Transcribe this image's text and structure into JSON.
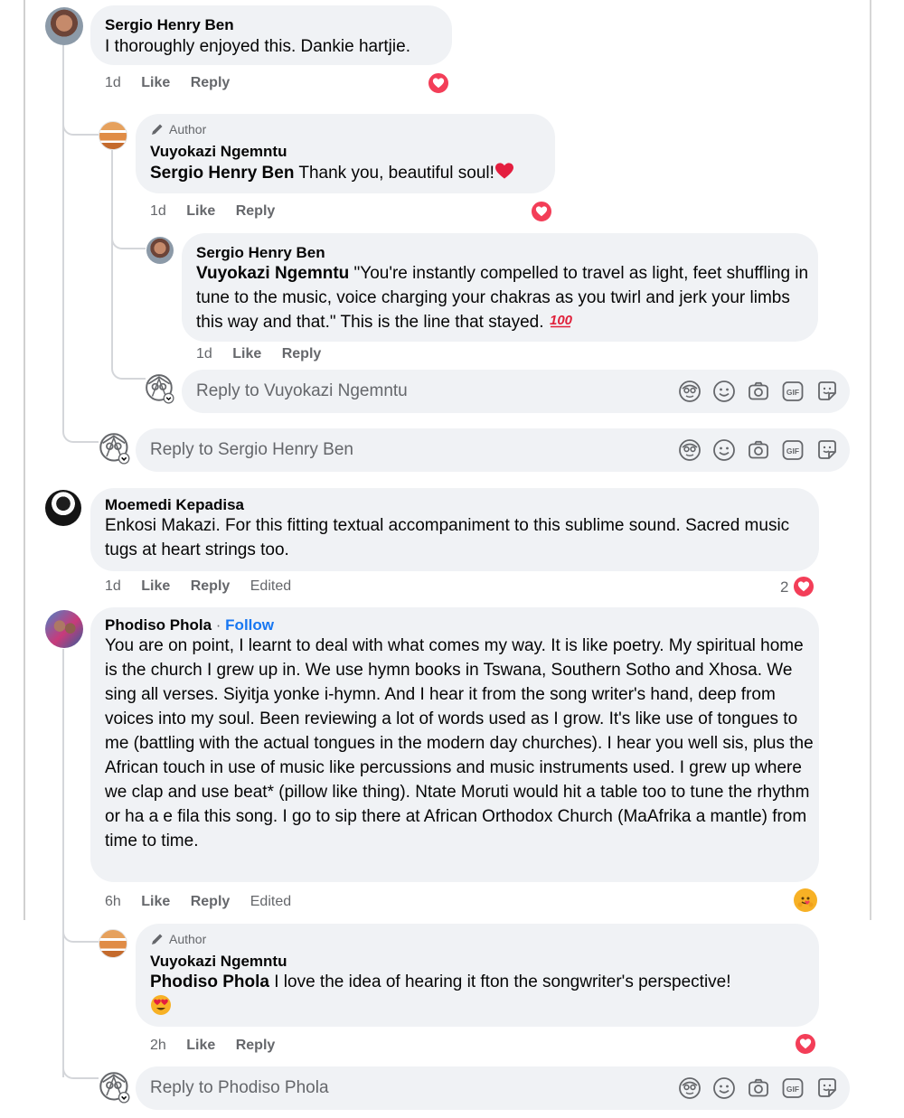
{
  "colors": {
    "bubble": "#f0f2f5",
    "link": "#1877f2",
    "muted": "#65676b",
    "heart": "#f33e58"
  },
  "icons": [
    "avatar-placeholder-icon",
    "heart-reaction-icon",
    "heart-emoji-icon",
    "hundred-points-emoji-icon",
    "hug-reaction-icon",
    "heart-eyes-emoji-icon",
    "pencil-icon",
    "avatar-sticker-icon",
    "emoji-icon",
    "camera-icon",
    "gif-icon",
    "sticker-icon"
  ],
  "comments": [
    {
      "name": "Sergio Henry Ben",
      "text": "I thoroughly enjoyed this. Dankie hartjie.",
      "time": "1d",
      "like": "Like",
      "reply": "Reply",
      "replies": [
        {
          "author_label": "Author",
          "name": "Vuyokazi Ngemntu",
          "mention": "Sergio Henry Ben",
          "text": " Thank you, beautiful soul!",
          "time": "1d",
          "like": "Like",
          "reply": "Reply",
          "replies": [
            {
              "name": "Sergio Henry Ben",
              "mention": "Vuyokazi Ngemntu",
              "text": " \"You're instantly compelled to travel as light, feet shuffling in tune to the music, voice charging your chakras as you twirl and jerk your limbs this way and that.\" This is the line that stayed. ",
              "time": "1d",
              "like": "Like",
              "reply": "Reply"
            }
          ],
          "reply_placeholder": "Reply to Vuyokazi Ngemntu"
        }
      ],
      "reply_placeholder": "Reply to Sergio Henry Ben"
    },
    {
      "name": "Moemedi Kepadisa",
      "text": "Enkosi Makazi. For this fitting textual accompaniment to this sublime sound. Sacred music tugs at heart strings too.",
      "time": "1d",
      "like": "Like",
      "reply": "Reply",
      "edited": "Edited",
      "reaction_count": "2"
    },
    {
      "name": "Phodiso Phola",
      "follow": "Follow",
      "follow_sep": " · ",
      "text": "You are on point, I learnt to deal with what comes my way. It is like poetry. My spiritual home is the church I grew up in. We use hymn books in Tswana, Southern Sotho and Xhosa. We sing all verses. Siyitja yonke i-hymn. And I hear it from the song writer's hand, deep from voices into my soul. Been reviewing a lot of words used as I grow. It's like use of tongues to me (battling with the actual tongues in the modern day churches). I hear you well sis, plus the African touch in use of music like percussions and music instruments used. I grew up where we clap and use beat* (pillow like thing). Ntate Moruti would hit a table too to tune the rhythm or ha a e fila this song. I go to sip there at African Orthodox Church (MaAfrika a mantle) from time to time.",
      "time": "6h",
      "like": "Like",
      "reply": "Reply",
      "edited": "Edited",
      "replies": [
        {
          "author_label": "Author",
          "name": "Vuyokazi Ngemntu",
          "mention": "Phodiso Phola",
          "text": " I love the idea of hearing it fton the songwriter's perspective!",
          "time": "2h",
          "like": "Like",
          "reply": "Reply"
        }
      ],
      "reply_placeholder": "Reply to Phodiso Phola"
    }
  ]
}
